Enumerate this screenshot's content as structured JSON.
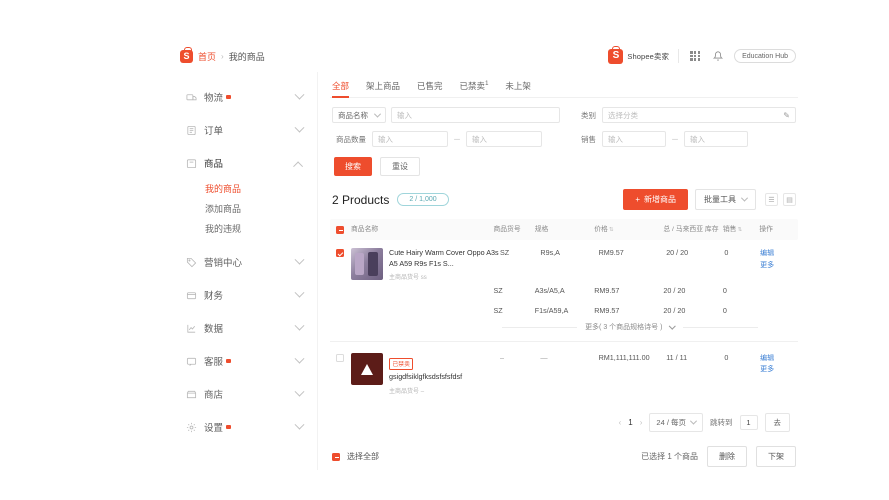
{
  "header": {
    "breadcrumb_home": "首页",
    "breadcrumb_sep": "›",
    "breadcrumb_current": "我的商品",
    "logo_text": "Shopee卖家",
    "education_hub": "Education Hub"
  },
  "sidebar": {
    "items": [
      {
        "label": "物流",
        "dot": true,
        "expanded": false
      },
      {
        "label": "订单",
        "dot": false,
        "expanded": false
      },
      {
        "label": "商品",
        "dot": false,
        "expanded": true
      },
      {
        "label": "营销中心",
        "dot": false,
        "expanded": false
      },
      {
        "label": "财务",
        "dot": false,
        "expanded": false
      },
      {
        "label": "数据",
        "dot": false,
        "expanded": false
      },
      {
        "label": "客服",
        "dot": true,
        "expanded": false
      },
      {
        "label": "商店",
        "dot": false,
        "expanded": false
      },
      {
        "label": "设置",
        "dot": true,
        "expanded": false
      }
    ],
    "sub_items": [
      {
        "label": "我的商品",
        "active": true
      },
      {
        "label": "添加商品",
        "active": false
      },
      {
        "label": "我的违规",
        "active": false
      }
    ]
  },
  "tabs": [
    {
      "label": "全部",
      "active": true,
      "sup": ""
    },
    {
      "label": "架上商品",
      "active": false,
      "sup": ""
    },
    {
      "label": "已售完",
      "active": false,
      "sup": ""
    },
    {
      "label": "已禁卖",
      "active": false,
      "sup": "1"
    },
    {
      "label": "未上架",
      "active": false,
      "sup": ""
    }
  ],
  "filters": {
    "name_select_value": "商品名称",
    "name_input_placeholder": "输入",
    "qty_label": "商品数量",
    "qty_min_placeholder": "输入",
    "qty_max_placeholder": "输入",
    "category_label": "类别",
    "category_placeholder": "选择分类",
    "sales_label": "销售",
    "sales_min_placeholder": "输入",
    "sales_max_placeholder": "输入",
    "range_dash": "－",
    "search_button": "搜索",
    "reset_button": "重设"
  },
  "products_bar": {
    "count_text": "2 Products",
    "quota": "2 / 1,000",
    "add_button": "新增商品",
    "add_icon": "+",
    "bulk_tools": "批量工具"
  },
  "table": {
    "columns": [
      "商品名称",
      "商品货号",
      "规格",
      "价格",
      "总 / 马来西亚 库存",
      "销售",
      "操作"
    ],
    "rows": [
      {
        "checked": true,
        "name": "Cute Hairy Warm Cover Oppo A3s A5 A59 R9s F1s S...",
        "sku_label": "主商品货号",
        "sku_value": "ss",
        "badge": "",
        "variants": [
          {
            "sku": "SZ",
            "spec": "R9s,A",
            "price": "RM9.57",
            "stock": "20 / 20",
            "sales": "0"
          },
          {
            "sku": "SZ",
            "spec": "A3s/A5,A",
            "price": "RM9.57",
            "stock": "20 / 20",
            "sales": "0"
          },
          {
            "sku": "SZ",
            "spec": "F1s/A59,A",
            "price": "RM9.57",
            "stock": "20 / 20",
            "sales": "0"
          }
        ],
        "actions": [
          "编辑",
          "更多"
        ],
        "more_variants": "更多( 3 个商品规格诗号 )"
      },
      {
        "checked": false,
        "name": "gsigdfsiklgfksdsfsfsfdsf",
        "sku_label": "主商品货号",
        "sku_value": "–",
        "badge": "已禁卖",
        "variants": [
          {
            "sku": "–",
            "spec": "—",
            "price": "RM1,111,111.00",
            "stock": "11 / 11",
            "sales": "0"
          }
        ],
        "actions": [
          "编辑",
          "更多"
        ],
        "more_variants": ""
      }
    ]
  },
  "pagination": {
    "prev": "‹",
    "page": "1",
    "next": "›",
    "page_size": "24 / 每页",
    "jump_label": "跳转到",
    "jump_value": "1",
    "go_button": "去"
  },
  "bottom_bar": {
    "select_all": "选择全部",
    "selected_count": "已选择 1 个商品",
    "delete_button": "删除",
    "unlist_button": "下架"
  },
  "colors": {
    "brand": "#ee4d2d",
    "link": "#3b7fd4",
    "quota_border": "#9fd5db"
  }
}
